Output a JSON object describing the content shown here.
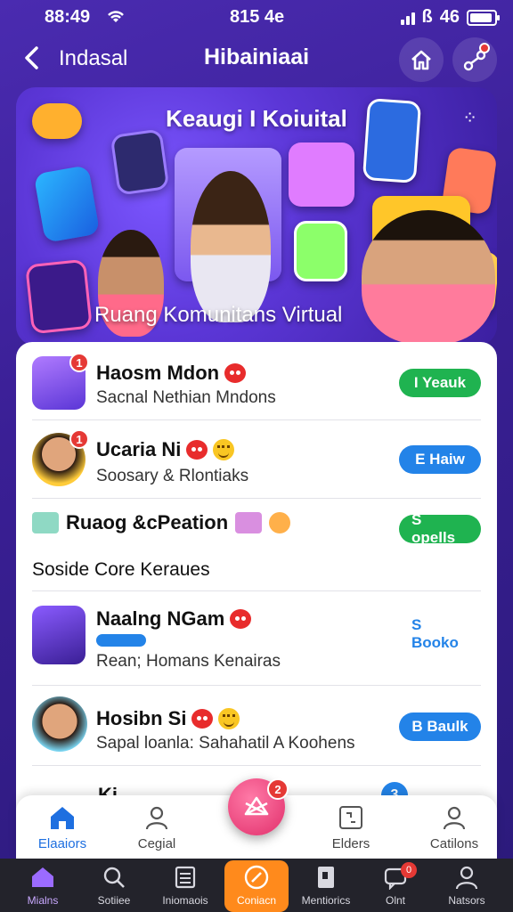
{
  "status_bar": {
    "time_left": "88:49",
    "time_center": "815 4e",
    "right_text": "46"
  },
  "header": {
    "back_label": "Indasal",
    "title": "Hibainiaai"
  },
  "banner": {
    "title": "Keaugi I Koiuital",
    "subtitle": "Ruang Komunitans Virtual"
  },
  "list": {
    "rows": [
      {
        "title": "Haosm Mdon",
        "subtitle": "Sacnal Nethian Mndons",
        "badge": "1",
        "action_label": "I Yeauk",
        "action_style": "green"
      },
      {
        "title": "Ucaria Ni",
        "subtitle": "Soosary & Rlontiaks",
        "badge": "1",
        "action_label": "E Haiw",
        "action_style": "blue"
      }
    ],
    "section": {
      "title": "Ruaog &cPeation",
      "action_label": "S opells",
      "subheading": "Soside Core Keraues"
    },
    "rows2": [
      {
        "title": "Naalng NGam",
        "subtitle": "Rean; Homans Kenairas",
        "action_label": "S Booko"
      },
      {
        "title": "Hosibn Si",
        "subtitle": "Sapal loanla: Sahahatil A Koohens",
        "action_label": "B Baulk"
      }
    ],
    "partial_row_title": "Ki",
    "partial_badge": "3"
  },
  "fab": {
    "badge": "2"
  },
  "tabbar": {
    "items": [
      {
        "label": "Elaaiors",
        "icon": "home-icon"
      },
      {
        "label": "Cegial",
        "icon": "profile-icon"
      },
      {
        "label": "Elders",
        "icon": "grid-icon"
      },
      {
        "label": "Catilons",
        "icon": "user-icon"
      }
    ]
  },
  "system_nav": {
    "items": [
      {
        "label": "Mialns"
      },
      {
        "label": "Sotiiee"
      },
      {
        "label": "Iniomaois"
      },
      {
        "label": "Coniacn"
      },
      {
        "label": "Mentiorics"
      },
      {
        "label": "Olnt"
      },
      {
        "label": "Natsors"
      }
    ],
    "badge": "0"
  },
  "colors": {
    "background": "#3a1f95",
    "green": "#1fb350",
    "blue": "#2383e8",
    "red": "#e53935",
    "orange": "#ff8a1c"
  }
}
